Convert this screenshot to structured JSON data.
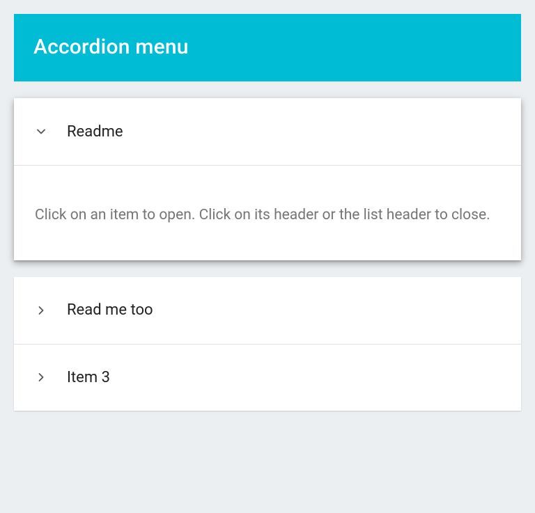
{
  "header": {
    "title": "Accordion menu"
  },
  "expanded": {
    "label": "Readme",
    "body": "Click on an item to open. Click on its header or the list header to close."
  },
  "collapsed": [
    {
      "label": "Read me too"
    },
    {
      "label": "Item 3"
    }
  ]
}
